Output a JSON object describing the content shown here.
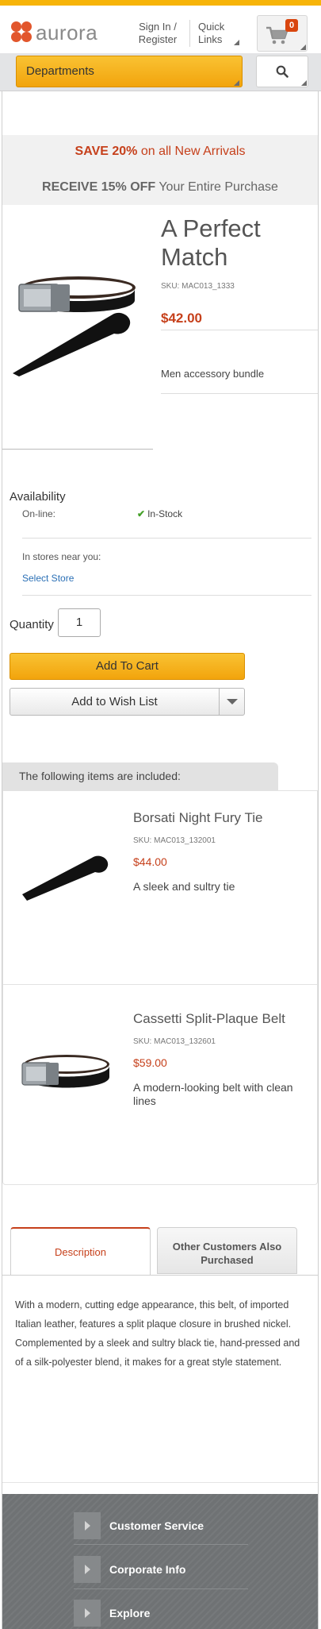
{
  "header": {
    "logo_text": "aurora",
    "sign_in_line1": "Sign In /",
    "sign_in_line2": "Register",
    "quick_links_line1": "Quick",
    "quick_links_line2": "Links",
    "cart_count": "0",
    "cart_icon": "shopping-cart-icon",
    "search_icon": "search-icon",
    "departments_label": "Departments",
    "accent_color": "#f7b409",
    "brand_color": "#e2562c"
  },
  "promo": {
    "line1_bold": "SAVE 20%",
    "line1_rest": " on all New Arrivals",
    "line2_bold": "RECEIVE 15% OFF",
    "line2_rest": " Your Entire Purchase"
  },
  "product": {
    "title": "A Perfect Match",
    "sku": "SKU: MAC013_1333",
    "price": "$42.00",
    "short_description": "Men accessory bundle",
    "availability_title": "Availability",
    "online_label": "On-line:",
    "online_status": "In-Stock",
    "stores_label": "In stores near you:",
    "select_store_label": "Select Store",
    "quantity_label": "Quantity",
    "quantity_value": "1",
    "add_to_cart_label": "Add To Cart",
    "wish_list_label": "Add to Wish List"
  },
  "included": {
    "header": "The following items are included:",
    "items": [
      {
        "name": "Borsati Night Fury Tie",
        "sku": "SKU: MAC013_132001",
        "price": "$44.00",
        "description": "A sleek and sultry tie"
      },
      {
        "name": "Cassetti Split-Plaque Belt",
        "sku": "SKU: MAC013_132601",
        "price": "$59.00",
        "description": "A modern-looking belt with clean lines"
      }
    ]
  },
  "tabs": {
    "description_label": "Description",
    "other_line1": "Other Customers Also",
    "other_line2": "Purchased",
    "description_text": "With a modern, cutting edge appearance, this belt, of imported Italian leather, features a split plaque closure in brushed nickel. Complemented by a sleek and sultry black tie, hand-pressed and of a silk-polyester blend, it makes for a great style statement."
  },
  "footer": {
    "items": [
      "Customer Service",
      "Corporate Info",
      "Explore"
    ]
  }
}
